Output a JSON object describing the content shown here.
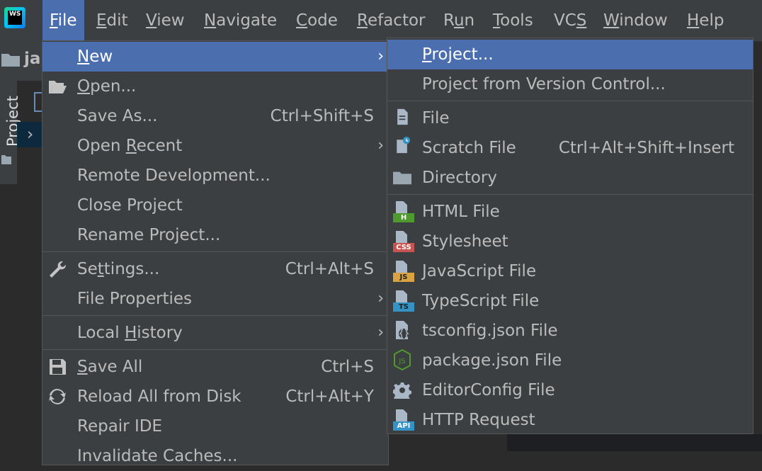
{
  "app": {
    "logo_text": "WS"
  },
  "menubar": {
    "items": [
      {
        "label": "File",
        "mnemonic": "F",
        "rest": "ile"
      },
      {
        "label": "Edit",
        "mnemonic": "E",
        "rest": "dit"
      },
      {
        "label": "View",
        "mnemonic": "V",
        "rest": "iew"
      },
      {
        "label": "Navigate",
        "mnemonic": "N",
        "rest": "avigate"
      },
      {
        "label": "Code",
        "mnemonic": "C",
        "rest": "ode"
      },
      {
        "label": "Refactor",
        "mnemonic": "R",
        "rest": "efactor"
      },
      {
        "label": "Run",
        "pre": "R",
        "mnemonic": "u",
        "rest": "n"
      },
      {
        "label": "Tools",
        "mnemonic": "T",
        "rest": "ools"
      },
      {
        "label": "VCS",
        "pre": "VC",
        "mnemonic": "S",
        "rest": ""
      },
      {
        "label": "Window",
        "mnemonic": "W",
        "rest": "indow"
      },
      {
        "label": "Help",
        "mnemonic": "H",
        "rest": "elp"
      }
    ]
  },
  "background": {
    "project_crumb": "ja",
    "side_panel_label": "Project"
  },
  "file_menu": {
    "items": [
      {
        "pre": "",
        "mn": "N",
        "post": "ew",
        "shortcut": "",
        "submenu": true,
        "icon": ""
      },
      {
        "pre": "",
        "mn": "O",
        "post": "pen...",
        "shortcut": "",
        "submenu": false,
        "icon": "folder-open-icon"
      },
      {
        "pre": "Save As...",
        "mn": "",
        "post": "",
        "shortcut": "Ctrl+Shift+S",
        "submenu": false,
        "icon": ""
      },
      {
        "pre": "Open ",
        "mn": "R",
        "post": "ecent",
        "shortcut": "",
        "submenu": true,
        "icon": ""
      },
      {
        "pre": "Remote Development...",
        "mn": "",
        "post": "",
        "shortcut": "",
        "submenu": false,
        "icon": ""
      },
      {
        "pre": "Close Project",
        "mn": "",
        "post": "",
        "shortcut": "",
        "submenu": false,
        "icon": ""
      },
      {
        "pre": "Rename Project...",
        "mn": "",
        "post": "",
        "shortcut": "",
        "submenu": false,
        "icon": ""
      },
      {
        "pre": "Se",
        "mn": "t",
        "post": "tings...",
        "shortcut": "Ctrl+Alt+S",
        "submenu": false,
        "icon": "wrench-icon"
      },
      {
        "pre": "File Properties",
        "mn": "",
        "post": "",
        "shortcut": "",
        "submenu": true,
        "icon": ""
      },
      {
        "pre": "Local ",
        "mn": "H",
        "post": "istory",
        "shortcut": "",
        "submenu": true,
        "icon": ""
      },
      {
        "pre": "",
        "mn": "S",
        "post": "ave All",
        "shortcut": "Ctrl+S",
        "submenu": false,
        "icon": "floppy-disk-icon"
      },
      {
        "pre": "Reload All from Disk",
        "mn": "",
        "post": "",
        "shortcut": "Ctrl+Alt+Y",
        "submenu": false,
        "icon": "reload-icon"
      },
      {
        "pre": "Repair IDE",
        "mn": "",
        "post": "",
        "shortcut": "",
        "submenu": false,
        "icon": ""
      }
    ],
    "partial_last": "Invalidate Caches..."
  },
  "new_submenu": {
    "items": [
      {
        "pre": "",
        "mn": "P",
        "post": "roject...",
        "shortcut": "",
        "icon": ""
      },
      {
        "pre": "Project from Version Control...",
        "mn": "",
        "post": "",
        "shortcut": "",
        "icon": ""
      },
      {
        "pre": "File",
        "mn": "",
        "post": "",
        "shortcut": "",
        "icon": "file-icon"
      },
      {
        "pre": "Scratch File",
        "mn": "",
        "post": "",
        "shortcut": "Ctrl+Alt+Shift+Insert",
        "icon": "scratch-file-icon"
      },
      {
        "pre": "Directory",
        "mn": "",
        "post": "",
        "shortcut": "",
        "icon": "folder-icon"
      },
      {
        "pre": "HTML File",
        "mn": "",
        "post": "",
        "shortcut": "",
        "icon": "html-file-icon",
        "tag": "H",
        "tag_color": "#4e9a2e"
      },
      {
        "pre": "Stylesheet",
        "mn": "",
        "post": "",
        "shortcut": "",
        "icon": "css-file-icon",
        "tag": "CSS",
        "tag_color": "#c75450"
      },
      {
        "pre": "JavaScript File",
        "mn": "",
        "post": "",
        "shortcut": "",
        "icon": "js-file-icon",
        "tag": "JS",
        "tag_color": "#d9a343"
      },
      {
        "pre": "TypeScript File",
        "mn": "",
        "post": "",
        "shortcut": "",
        "icon": "ts-file-icon",
        "tag": "TS",
        "tag_color": "#3592c4"
      },
      {
        "pre": "tsconfig.json File",
        "mn": "",
        "post": "",
        "shortcut": "",
        "icon": "tsconfig-icon"
      },
      {
        "pre": "package.json File",
        "mn": "",
        "post": "",
        "shortcut": "",
        "icon": "nodejs-icon"
      },
      {
        "pre": "EditorConfig File",
        "mn": "",
        "post": "",
        "shortcut": "",
        "icon": "gear-icon"
      },
      {
        "pre": "HTTP Request",
        "mn": "",
        "post": "",
        "shortcut": "",
        "icon": "http-request-icon",
        "tag": "API",
        "tag_color": "#3592c4"
      }
    ]
  },
  "colors": {
    "highlight": "#4b6eaf",
    "menu_bg": "#3c3f41",
    "text": "#bbbbbb",
    "separator": "#555555"
  }
}
